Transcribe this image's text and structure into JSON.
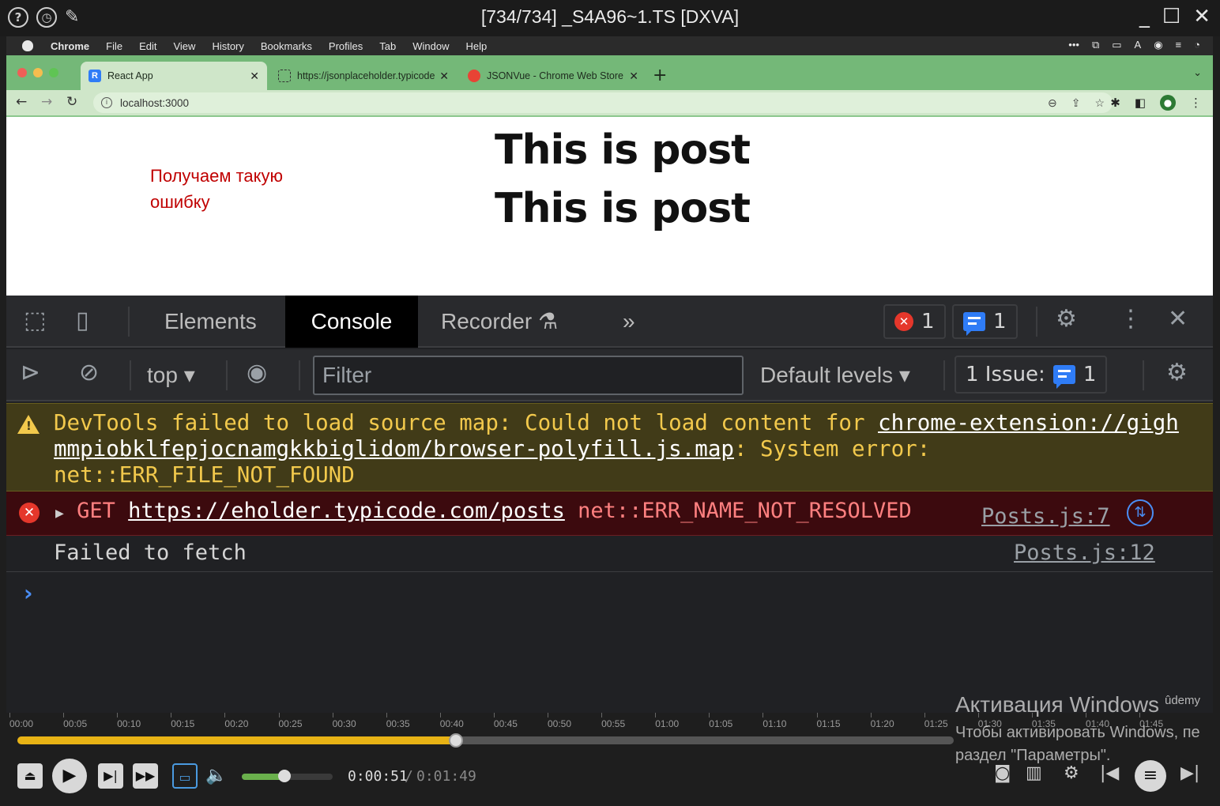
{
  "player": {
    "title": "[734/734] _S4A96~1.TS [DXVA]",
    "left_icons": [
      "help-icon",
      "history-icon",
      "pin-icon"
    ],
    "window_controls": [
      "minimize-icon",
      "maximize-icon",
      "close-icon"
    ],
    "timeline_ticks": [
      "00:00",
      "00:05",
      "00:10",
      "00:15",
      "00:20",
      "00:25",
      "00:30",
      "00:35",
      "00:40",
      "00:45",
      "00:50",
      "00:55",
      "01:00",
      "01:05",
      "01:10",
      "01:15",
      "01:20",
      "01:25",
      "01:30",
      "01:35",
      "01:40",
      "01:45"
    ],
    "progress": 0.468,
    "volume": 0.47,
    "current_time": "0:00:51",
    "time_separator": "/",
    "total_time": "0:01:49",
    "accent_color": "#e8b315"
  },
  "mac_menu": {
    "items": [
      "Chrome",
      "File",
      "Edit",
      "View",
      "History",
      "Bookmarks",
      "Profiles",
      "Tab",
      "Window",
      "Help"
    ]
  },
  "browser": {
    "tabs": [
      {
        "label": "React App",
        "favicon": "R",
        "active": true
      },
      {
        "label": "https://jsonplaceholder.typicode",
        "favicon": "",
        "active": false
      },
      {
        "label": "JSONVue - Chrome Web Store",
        "favicon": "",
        "active": false
      }
    ],
    "url": "localhost:3000"
  },
  "page": {
    "posts": [
      "This is post",
      "This is post"
    ],
    "annotation": "Получаем такую ошибку"
  },
  "devtools": {
    "tabs": [
      "Elements",
      "Console",
      "Recorder"
    ],
    "active_tab": "Console",
    "more_tabs": "»",
    "error_count": "1",
    "message_count": "1",
    "context": "top",
    "filter_placeholder": "Filter",
    "levels": "Default levels",
    "issues_label": "1 Issue:",
    "issues_count": "1",
    "warning": {
      "prefix": "DevTools failed to load source map: Could not load content for ",
      "link": "chrome-extension://gighmmpiobklfepjocnamgkkbiglidom/browser-polyfill.js.map",
      "suffix": ": System error: net::ERR_FILE_NOT_FOUND"
    },
    "error": {
      "method": "GET",
      "url": "https://eholder.typicode.com/posts",
      "code": "net::ERR_NAME_NOT_RESOLVED",
      "source": "Posts.js:7"
    },
    "log": {
      "text": "Failed to fetch",
      "source": "Posts.js:12"
    },
    "prompt": "›"
  },
  "watermark": {
    "line1": "Активация Windows",
    "line2": "Чтобы активировать Windows, пе",
    "line3": "раздел \"Параметры\".",
    "brand": "ûdemy"
  }
}
